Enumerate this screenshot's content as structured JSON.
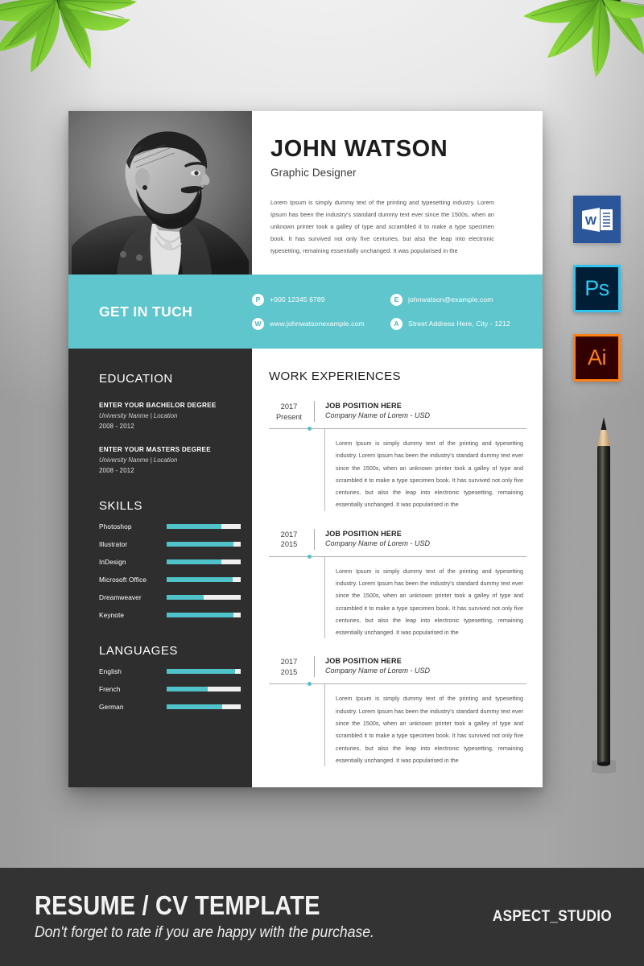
{
  "colors": {
    "teal": "#5ec6cc",
    "bar_fill": "#4fc3c9",
    "sidebar_dark": "#2e2e2e",
    "footer_dark": "#333333",
    "word_blue": "#2b579a",
    "photoshop_cyan": "#31c5f0",
    "illustrator_orange": "#ff7f18"
  },
  "resume": {
    "name": "JOHN WATSON",
    "role": "Graphic Designer",
    "intro": "Lorem Ipsum is simply dummy text of the printing and typesetting industry. Lorem Ipsum has been the industry's standard dummy text ever since the 1500s, when an unknown printer took a galley of type and scrambled it to make a type specimen book. It has survived not only five centuries, but also the leap into electronic typesetting, remaining essentially unchanged. It was popularised in the",
    "contact": {
      "title": "GET IN TUCH",
      "items": [
        {
          "badge": "P",
          "icon": "phone-icon",
          "text": "+000 12345 6789"
        },
        {
          "badge": "E",
          "icon": "email-icon",
          "text": "johnwatson@example.com"
        },
        {
          "badge": "W",
          "icon": "website-icon",
          "text": "www.johnwatsonexample.com"
        },
        {
          "badge": "A",
          "icon": "address-icon",
          "text": "Street Address Here, City - 1212"
        }
      ]
    },
    "education": {
      "title": "EDUCATION",
      "items": [
        {
          "degree": "ENTER YOUR BACHELOR DEGREE",
          "university": "University Nanme | Location",
          "years": "2008 - 2012"
        },
        {
          "degree": "ENTER YOUR MASTERS DEGREE",
          "university": "University Nanme | Location",
          "years": "2008 - 2012"
        }
      ]
    },
    "skills": {
      "title": "SKILLS",
      "items": [
        {
          "label": "Photoshop",
          "value": 74
        },
        {
          "label": "Illustrator",
          "value": 90
        },
        {
          "label": "InDesign",
          "value": 74
        },
        {
          "label": "Microsoft Office",
          "value": 89
        },
        {
          "label": "Dreamweaver",
          "value": 50
        },
        {
          "label": "Keynote",
          "value": 90
        }
      ]
    },
    "languages": {
      "title": "LANGUAGES",
      "items": [
        {
          "label": "English",
          "value": 92
        },
        {
          "label": "French",
          "value": 55
        },
        {
          "label": "German",
          "value": 75
        }
      ]
    },
    "work": {
      "title": "WORK EXPERIENCES",
      "items": [
        {
          "year_from": "2017",
          "year_to": "Present",
          "position": "JOB POSITION HERE",
          "company": "Company Name of Lorem - USD",
          "description": "Lorem Ipsum is simply dummy text of the printing and typesetting industry. Lorem Ipsum has been the industry's standard dummy text ever since the 1500s, when an unknown printer took a galley of type and scrambled it to make a type specimen book. It has survived not only five centuries, but also the leap into electronic typesetting, remaining essentially unchanged. It was popularised in the"
        },
        {
          "year_from": "2017",
          "year_to": "2015",
          "position": "JOB POSITION HERE",
          "company": "Company Name of Lorem - USD",
          "description": "Lorem Ipsum is simply dummy text of the printing and typesetting industry. Lorem Ipsum has been the industry's standard dummy text ever since the 1500s, when an unknown printer took a galley of type and scrambled it to make a type specimen book. It has survived not only five centuries, but also the leap into electronic typesetting, remaining essentially unchanged. It was popularised in the"
        },
        {
          "year_from": "2017",
          "year_to": "2015",
          "position": "JOB POSITION HERE",
          "company": "Company Name of Lorem - USD",
          "description": "Lorem Ipsum is simply dummy text of the printing and typesetting industry. Lorem Ipsum has been the industry's standard dummy text ever since the 1500s, when an unknown printer took a galley of type and scrambled it to make a type specimen book. It has survived not only five centuries, but also the leap into electronic typesetting, remaining essentially unchanged. It was popularised in the"
        }
      ]
    }
  },
  "badges": [
    {
      "name": "microsoft-word-badge",
      "label": "W"
    },
    {
      "name": "photoshop-badge",
      "label": "Ps"
    },
    {
      "name": "illustrator-badge",
      "label": "Ai"
    }
  ],
  "footer": {
    "title": "RESUME / CV TEMPLATE",
    "subtitle": "Don't forget to rate if you are happy with the purchase.",
    "studio": "ASPECT_STUDIO"
  }
}
